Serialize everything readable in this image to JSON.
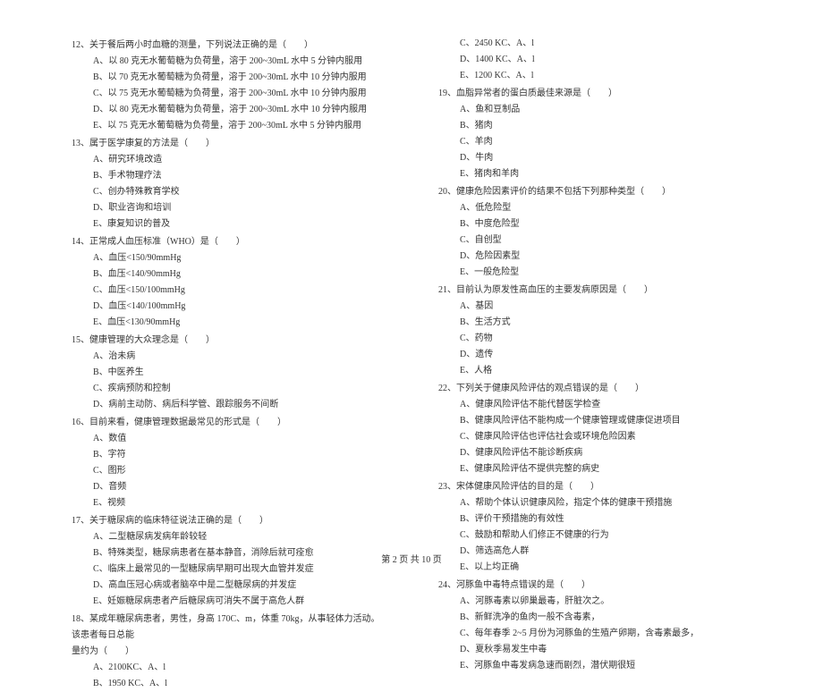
{
  "left": [
    {
      "type": "stem",
      "text": "12、关于餐后两小时血糖的测量，下列说法正确的是（　　）"
    },
    {
      "type": "opt",
      "text": "A、以 80 克无水葡萄糖为负荷量，溶于 200~30mL 水中 5 分钟内服用"
    },
    {
      "type": "opt",
      "text": "B、以 70 克无水葡萄糖为负荷量，溶于 200~30mL 水中 10 分钟内服用"
    },
    {
      "type": "opt",
      "text": "C、以 75 克无水葡萄糖为负荷量，溶于 200~30mL 水中 10 分钟内服用"
    },
    {
      "type": "opt",
      "text": "D、以 80 克无水葡萄糖为负荷量，溶于 200~30mL 水中 10 分钟内服用"
    },
    {
      "type": "opt",
      "text": "E、以 75 克无水葡萄糖为负荷量，溶于 200~30mL 水中 5 分钟内服用"
    },
    {
      "type": "stem",
      "text": "13、属于医学康复的方法是（　　）"
    },
    {
      "type": "opt",
      "text": "A、研究环境改造"
    },
    {
      "type": "opt",
      "text": "B、手术物理疗法"
    },
    {
      "type": "opt",
      "text": "C、创办特殊教育学校"
    },
    {
      "type": "opt",
      "text": "D、职业咨询和培训"
    },
    {
      "type": "opt",
      "text": "E、康复知识的普及"
    },
    {
      "type": "stem",
      "text": "14、正常成人血压标准（WHO）是（　　）"
    },
    {
      "type": "opt",
      "text": "A、血压<150/90mmHg"
    },
    {
      "type": "opt",
      "text": "B、血压<140/90mmHg"
    },
    {
      "type": "opt",
      "text": "C、血压<150/100mmHg"
    },
    {
      "type": "opt",
      "text": "D、血压<140/100mmHg"
    },
    {
      "type": "opt",
      "text": "E、血压<130/90mmHg"
    },
    {
      "type": "stem",
      "text": "15、健康管理的大众理念是（　　）"
    },
    {
      "type": "opt",
      "text": "A、治未病"
    },
    {
      "type": "opt",
      "text": "B、中医养生"
    },
    {
      "type": "opt",
      "text": "C、疾病预防和控制"
    },
    {
      "type": "opt",
      "text": "D、病前主动防、病后科学管、跟踪服务不间断"
    },
    {
      "type": "stem",
      "text": "16、目前来看，健康管理数据最常见的形式是（　　）"
    },
    {
      "type": "opt",
      "text": "A、数值"
    },
    {
      "type": "opt",
      "text": "B、字符"
    },
    {
      "type": "opt",
      "text": "C、图形"
    },
    {
      "type": "opt",
      "text": "D、音频"
    },
    {
      "type": "opt",
      "text": "E、视频"
    },
    {
      "type": "stem",
      "text": "17、关于糖尿病的临床特征说法正确的是（　　）"
    },
    {
      "type": "opt",
      "text": "A、二型糖尿病发病年龄较轻"
    },
    {
      "type": "opt",
      "text": "B、特殊类型，糖尿病患者在基本静音，消除后就可痊愈"
    },
    {
      "type": "opt",
      "text": "C、临床上最常见的一型糖尿病早期可出现大血管并发症"
    },
    {
      "type": "opt",
      "text": "D、高血压冠心病或者脑卒中是二型糖尿病的并发症"
    },
    {
      "type": "opt",
      "text": "E、妊娠糖尿病患者产后糖尿病可消失不属于高危人群"
    },
    {
      "type": "stem",
      "text": "18、某成年糖尿病患者，男性，身高 170C、m，体重 70kg，从事轻体力活动。该患者每日总能"
    },
    {
      "type": "cont",
      "text": "量约为（　　）"
    },
    {
      "type": "opt",
      "text": "A、2100KC、A、l"
    },
    {
      "type": "opt",
      "text": "B、1950 KC、A、l"
    }
  ],
  "right": [
    {
      "type": "opt",
      "text": "C、2450 KC、A、l"
    },
    {
      "type": "opt",
      "text": "D、1400 KC、A、l"
    },
    {
      "type": "opt",
      "text": "E、1200 KC、A、l"
    },
    {
      "type": "stem",
      "text": "19、血脂异常者的蛋白质最佳来源是（　　）"
    },
    {
      "type": "opt",
      "text": "A、鱼和豆制品"
    },
    {
      "type": "opt",
      "text": "B、猪肉"
    },
    {
      "type": "opt",
      "text": "C、羊肉"
    },
    {
      "type": "opt",
      "text": "D、牛肉"
    },
    {
      "type": "opt",
      "text": "E、猪肉和羊肉"
    },
    {
      "type": "stem",
      "text": "20、健康危险因素评价的结果不包括下列那种类型（　　）"
    },
    {
      "type": "opt",
      "text": "A、低危险型"
    },
    {
      "type": "opt",
      "text": "B、中度危险型"
    },
    {
      "type": "opt",
      "text": "C、自创型"
    },
    {
      "type": "opt",
      "text": "D、危险因素型"
    },
    {
      "type": "opt",
      "text": "E、一般危险型"
    },
    {
      "type": "stem",
      "text": "21、目前认为原发性高血压的主要发病原因是（　　）"
    },
    {
      "type": "opt",
      "text": "A、基因"
    },
    {
      "type": "opt",
      "text": "B、生活方式"
    },
    {
      "type": "opt",
      "text": "C、药物"
    },
    {
      "type": "opt",
      "text": "D、遗传"
    },
    {
      "type": "opt",
      "text": "E、人格"
    },
    {
      "type": "stem",
      "text": "22、下列关于健康风险评估的观点错误的是（　　）"
    },
    {
      "type": "opt",
      "text": "A、健康风险评估不能代替医学检查"
    },
    {
      "type": "opt",
      "text": "B、健康风险评估不能构成一个健康管理或健康促进项目"
    },
    {
      "type": "opt",
      "text": "C、健康风险评估也评估社会或环境危险因素"
    },
    {
      "type": "opt",
      "text": "D、健康风险评估不能诊断疾病"
    },
    {
      "type": "opt",
      "text": "E、健康风险评估不提供完整的病史"
    },
    {
      "type": "stem",
      "text": "23、宋体健康风险评估的目的是（　　）"
    },
    {
      "type": "opt",
      "text": "A、帮助个体认识健康风险，指定个体的健康干预措施"
    },
    {
      "type": "opt",
      "text": "B、评价干预措施的有效性"
    },
    {
      "type": "opt",
      "text": "C、鼓励和帮助人们修正不健康的行为"
    },
    {
      "type": "opt",
      "text": "D、筛选高危人群"
    },
    {
      "type": "opt",
      "text": "E、以上均正确"
    },
    {
      "type": "stem",
      "text": "24、河豚鱼中毒特点错误的是（　　）"
    },
    {
      "type": "opt",
      "text": "A、河豚毒素以卵巢最毒，肝脏次之。"
    },
    {
      "type": "opt",
      "text": "B、新鲜洗净的鱼肉一般不含毒素，"
    },
    {
      "type": "opt",
      "text": "C、每年春季 2~5 月份为河豚鱼的生殖产卵期，含毒素最多，"
    },
    {
      "type": "opt",
      "text": "D、夏秋季易发生中毒"
    },
    {
      "type": "opt",
      "text": "E、河豚鱼中毒发病急速而剧烈，潜伏期很短"
    }
  ],
  "footer": "第 2 页 共 10 页"
}
